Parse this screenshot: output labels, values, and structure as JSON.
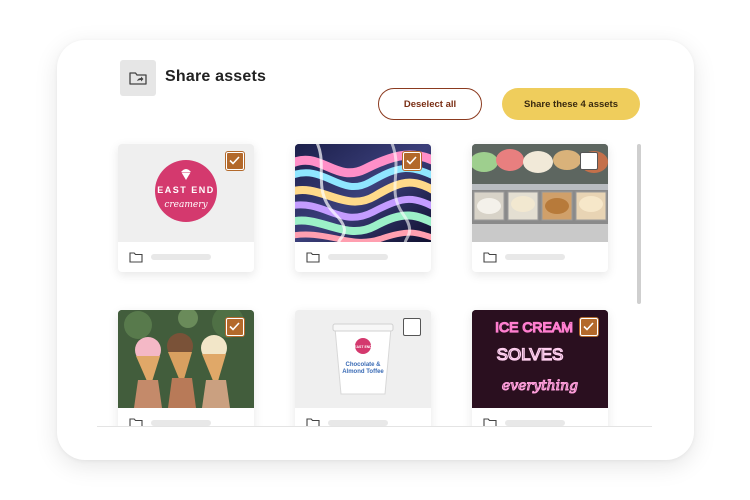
{
  "header": {
    "title": "Share assets",
    "icon": "folder-share-icon"
  },
  "actions": {
    "deselect_label": "Deselect all",
    "share_label": "Share these 4 assets"
  },
  "colors": {
    "accent_yellow": "#efcd5c",
    "deselect_border": "#8b3a1f",
    "checkbox_checked": "#b3692b"
  },
  "assets": [
    {
      "thumbnail": "east-end-creamery-logo",
      "logo_text_top": "EAST END",
      "logo_text_script": "creamery",
      "selected": true
    },
    {
      "thumbnail": "iridescent-swirl-abstract",
      "selected": true
    },
    {
      "thumbnail": "gelato-display-case",
      "selected": false
    },
    {
      "thumbnail": "hands-holding-ice-cream-cones",
      "selected": true
    },
    {
      "thumbnail": "ice-cream-pint-container",
      "pint_brand_top": "EAST END",
      "pint_label_line1": "Chocolate &",
      "pint_label_line2": "Almond Toffee",
      "selected": false
    },
    {
      "thumbnail": "neon-sign-ice-cream",
      "neon_line1": "ICE CREAM",
      "neon_line2": "SOLVES",
      "neon_line3": "everything",
      "selected": true
    }
  ]
}
